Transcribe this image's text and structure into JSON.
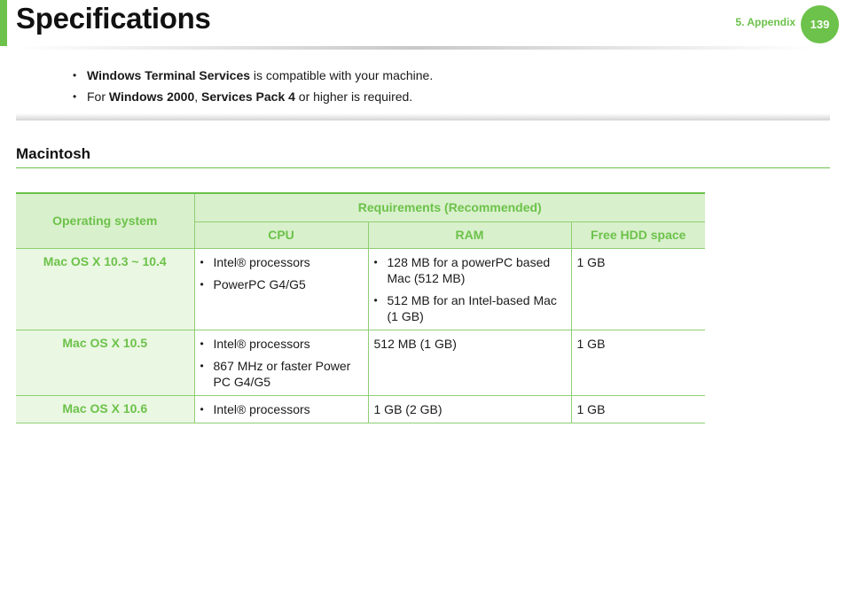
{
  "header": {
    "title": "Specifications",
    "chapter": "5.  Appendix",
    "page_number": "139",
    "accent_color": "#6cc24a"
  },
  "notes": [
    {
      "bold": "Windows Terminal Services",
      "rest": " is compatible with your machine."
    },
    {
      "pre": "For ",
      "bold1": "Windows 2000",
      "mid": ", ",
      "bold2": "Services Pack 4",
      "rest": " or higher is required."
    }
  ],
  "section": {
    "title": "Macintosh"
  },
  "table": {
    "head": {
      "os": "Operating system",
      "requirements": "Requirements (Recommended)",
      "cpu": "CPU",
      "ram": "RAM",
      "hdd": "Free HDD space"
    },
    "rows": [
      {
        "os": "Mac OS X 10.3 ~ 10.4",
        "cpu": [
          "Intel® processors",
          "PowerPC G4/G5"
        ],
        "ram": [
          "128 MB for a powerPC based Mac (512 MB)",
          "512 MB for an Intel-based Mac (1 GB)"
        ],
        "hdd": "1 GB"
      },
      {
        "os": "Mac OS X 10.5",
        "cpu": [
          "Intel® processors",
          "867 MHz or faster Power PC G4/G5"
        ],
        "ram_text": "512 MB (1 GB)",
        "hdd": "1 GB"
      },
      {
        "os": "Mac OS X 10.6",
        "cpu": [
          "Intel® processors"
        ],
        "ram_text": "1 GB (2 GB)",
        "hdd": "1 GB"
      }
    ]
  }
}
